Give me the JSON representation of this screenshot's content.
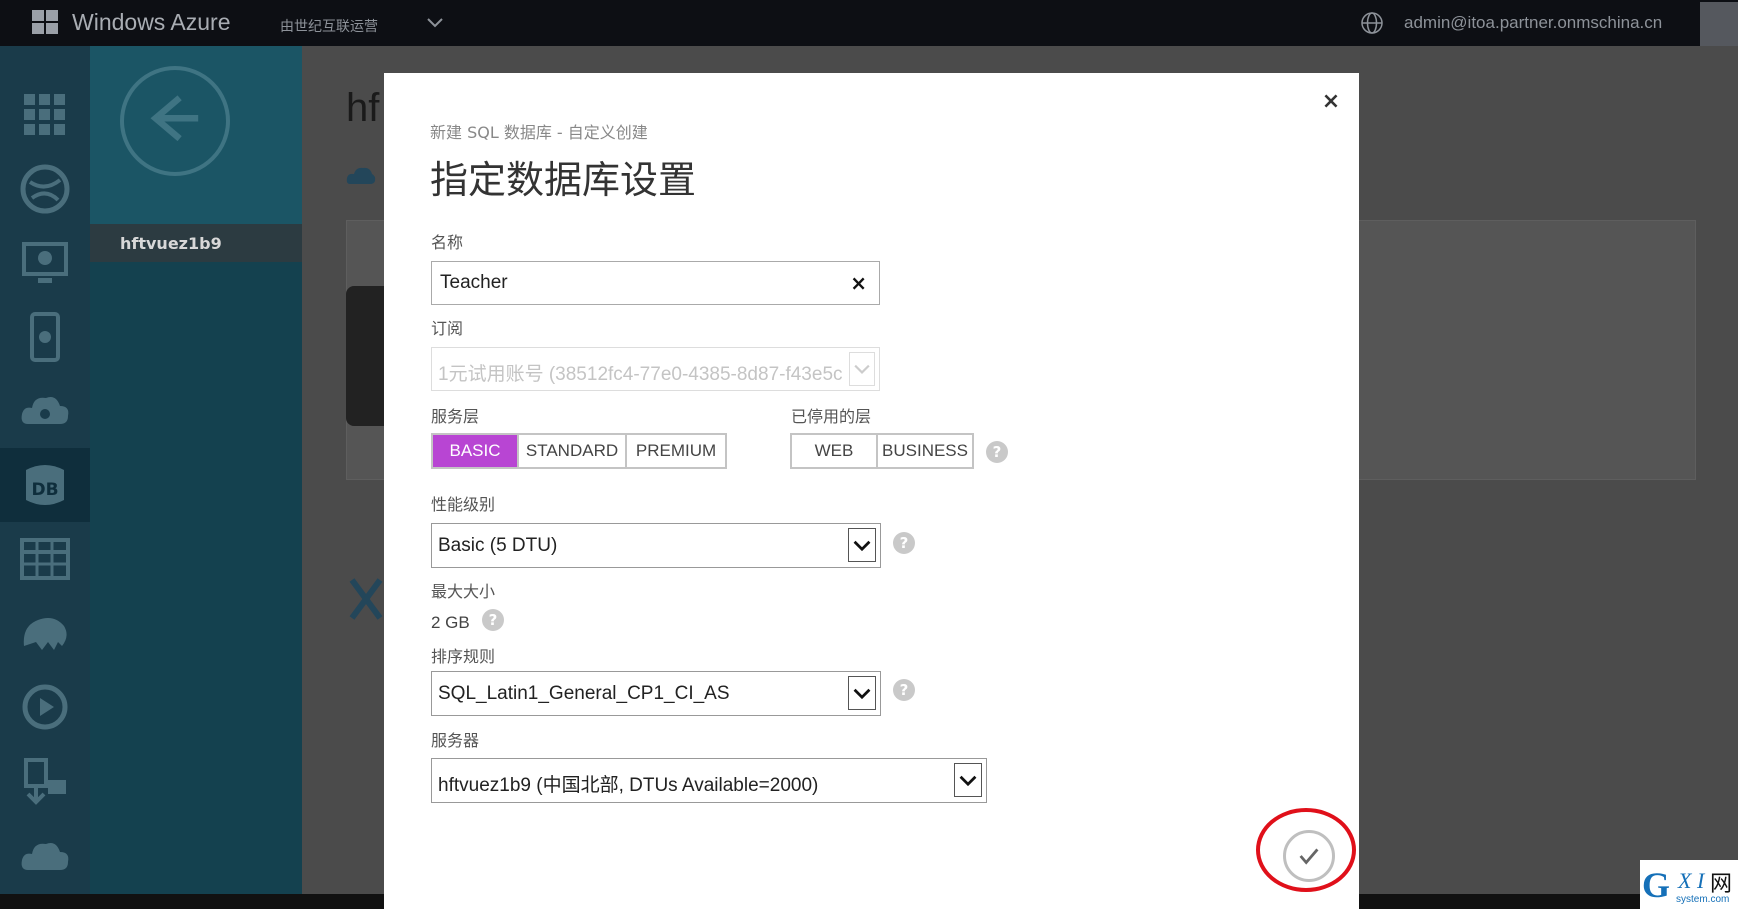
{
  "topbar": {
    "brand": "Windows Azure",
    "operator": "由世纪互联运营",
    "user_email": "admin@itoa.partner.onmschina.cn"
  },
  "sidebar": {
    "server_item": "hftvuez1b9"
  },
  "main": {
    "title_peek": "hf"
  },
  "modal": {
    "breadcrumb": "新建 SQL 数据库 - 自定义创建",
    "heading": "指定数据库设置",
    "name": {
      "label": "名称",
      "value": "Teacher"
    },
    "subscription": {
      "label": "订阅",
      "value": "1元试用账号 (38512fc4-77e0-4385-8d87-f43e5c"
    },
    "service_tier": {
      "label": "服务层",
      "options": [
        "BASIC",
        "STANDARD",
        "PREMIUM"
      ],
      "selected": "BASIC"
    },
    "retired_tier": {
      "label": "已停用的层",
      "options": [
        "WEB",
        "BUSINESS"
      ]
    },
    "performance": {
      "label": "性能级别",
      "value": "Basic (5 DTU)"
    },
    "max_size": {
      "label": "最大大小",
      "value": "2 GB"
    },
    "collation": {
      "label": "排序规则",
      "value": "SQL_Latin1_General_CP1_CI_AS"
    },
    "server": {
      "label": "服务器",
      "value": "hftvuez1b9 (中国北部, DTUs Available=2000)"
    },
    "help_glyph": "?",
    "close_glyph": "×",
    "clear_glyph": "×"
  },
  "watermark": {
    "g": "G",
    "xi": "X I",
    "wang": "网",
    "url": "system.com"
  },
  "colors": {
    "accent_selected": "#b845d3",
    "highlight_ring": "#e0101a",
    "rail_bg": "#1a3b4a"
  }
}
